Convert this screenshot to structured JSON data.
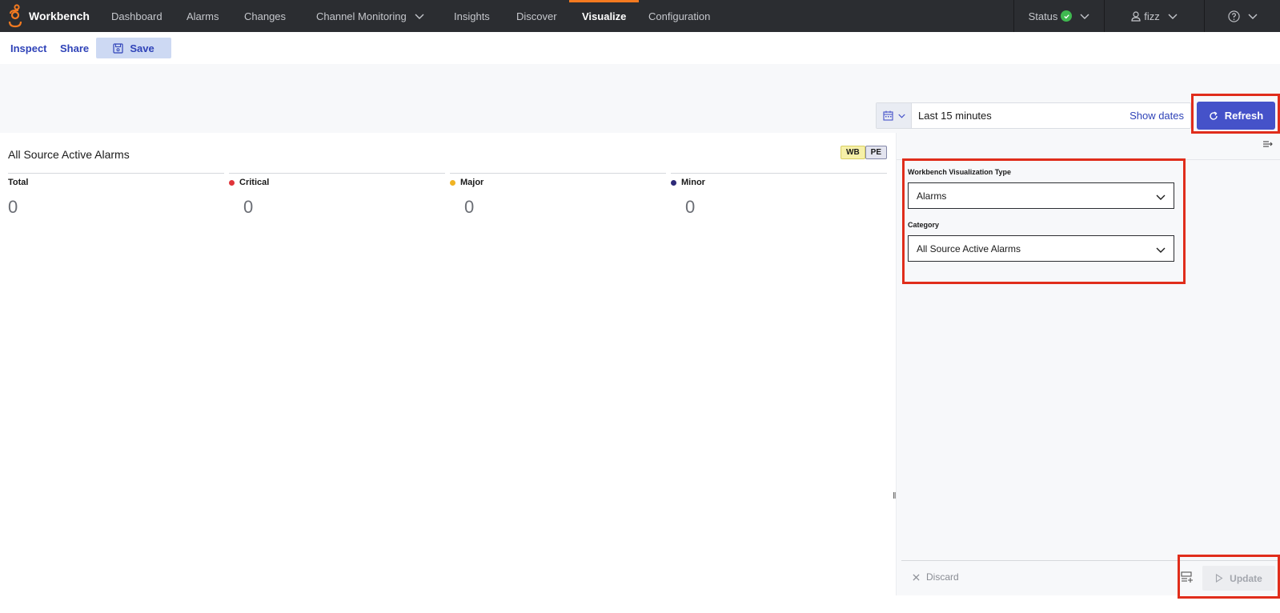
{
  "app": {
    "name": "Workbench"
  },
  "nav": {
    "items": [
      {
        "label": "Dashboard"
      },
      {
        "label": "Alarms"
      },
      {
        "label": "Changes"
      },
      {
        "label": "Channel Monitoring"
      },
      {
        "label": "Insights"
      },
      {
        "label": "Discover"
      },
      {
        "label": "Visualize",
        "active": true
      },
      {
        "label": "Configuration"
      }
    ],
    "status_label": "Status",
    "user_label": "fizz"
  },
  "toolbar": {
    "inspect_label": "Inspect",
    "share_label": "Share",
    "save_label": "Save"
  },
  "filter": {
    "range_label": "Last 15 minutes",
    "show_dates_label": "Show dates",
    "refresh_label": "Refresh"
  },
  "main": {
    "title": "All Source Active Alarms",
    "badges": [
      "WB",
      "PE"
    ],
    "metrics": [
      {
        "label": "Total",
        "value": "0",
        "color": ""
      },
      {
        "label": "Critical",
        "value": "0",
        "color": "#e0343a"
      },
      {
        "label": "Major",
        "value": "0",
        "color": "#f0b323"
      },
      {
        "label": "Minor",
        "value": "0",
        "color": "#2d2a78"
      }
    ]
  },
  "side": {
    "viz_type_label": "Workbench Visualization Type",
    "viz_type_value": "Alarms",
    "category_label": "Category",
    "category_value": "All Source Active Alarms",
    "discard_label": "Discard",
    "update_label": "Update"
  },
  "colors": {
    "accent": "#4552c9",
    "highlight": "#e02d1b",
    "nav_bg": "#2b2d31",
    "active_tab": "#f47a20"
  }
}
